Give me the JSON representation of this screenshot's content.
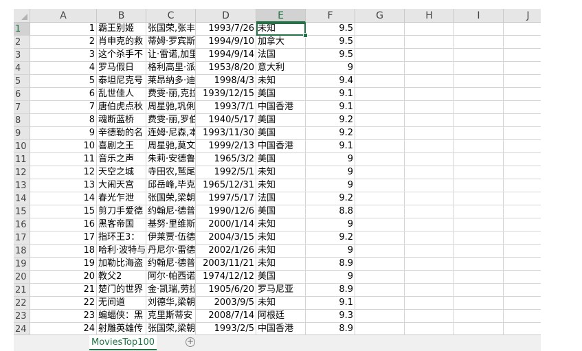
{
  "spreadsheet": {
    "columns": [
      "A",
      "B",
      "C",
      "D",
      "E",
      "F",
      "G",
      "H",
      "I",
      "J"
    ],
    "selected_column": "E",
    "selected_row": 1,
    "rows": [
      {
        "row": "1",
        "a": "1",
        "b": "霸王别姬",
        "c": "张国荣,张丰",
        "d": "1993/7/26",
        "e": "未知",
        "f": "9.5"
      },
      {
        "row": "2",
        "a": "2",
        "b": "肖申克的救",
        "c": "蒂姆·罗宾斯",
        "d": "1994/9/10",
        "e": "加拿大",
        "f": "9.5"
      },
      {
        "row": "3",
        "a": "3",
        "b": "这个杀手不",
        "c": "让·雷诺,加里",
        "d": "1994/9/14",
        "e": "法国",
        "f": "9.5"
      },
      {
        "row": "4",
        "a": "4",
        "b": "罗马假日",
        "c": "格利高里·派",
        "d": "1953/8/20",
        "e": "意大利",
        "f": "9"
      },
      {
        "row": "5",
        "a": "5",
        "b": "泰坦尼克号",
        "c": "莱昂纳多·迪",
        "d": "1998/4/3",
        "e": "未知",
        "f": "9.4"
      },
      {
        "row": "6",
        "a": "6",
        "b": "乱世佳人",
        "c": "费雯·丽,克拉",
        "d": "1939/12/15",
        "e": "美国",
        "f": "9.1"
      },
      {
        "row": "7",
        "a": "7",
        "b": "唐伯虎点秋",
        "c": "周星驰,巩俐",
        "d": "1993/7/1",
        "e": "中国香港",
        "f": "9.1"
      },
      {
        "row": "8",
        "a": "8",
        "b": "魂断蓝桥",
        "c": "费雯·丽,罗伯",
        "d": "1940/5/17",
        "e": "美国",
        "f": "9.2"
      },
      {
        "row": "9",
        "a": "9",
        "b": "辛德勒的名",
        "c": "连姆·尼森,本",
        "d": "1993/11/30",
        "e": "美国",
        "f": "9.2"
      },
      {
        "row": "10",
        "a": "10",
        "b": "喜剧之王",
        "c": "周星驰,莫文",
        "d": "1999/2/13",
        "e": "中国香港",
        "f": "9.1"
      },
      {
        "row": "11",
        "a": "11",
        "b": "音乐之声",
        "c": "朱莉·安德鲁",
        "d": "1965/3/2",
        "e": "美国",
        "f": "9"
      },
      {
        "row": "12",
        "a": "12",
        "b": "天空之城",
        "c": "寺田农,鹫尾",
        "d": "1992/5/1",
        "e": "未知",
        "f": "9"
      },
      {
        "row": "13",
        "a": "13",
        "b": "大闹天宫",
        "c": "邱岳峰,毕克",
        "d": "1965/12/31",
        "e": "未知",
        "f": "9"
      },
      {
        "row": "14",
        "a": "14",
        "b": "春光乍泄",
        "c": "张国荣,梁朝",
        "d": "1997/5/17",
        "e": "法国",
        "f": "9.2"
      },
      {
        "row": "15",
        "a": "15",
        "b": "剪刀手爱德",
        "c": "约翰尼·德普",
        "d": "1990/12/6",
        "e": "美国",
        "f": "8.8"
      },
      {
        "row": "16",
        "a": "16",
        "b": "黑客帝国",
        "c": "基努·里维斯",
        "d": "2000/1/14",
        "e": "未知",
        "f": "9"
      },
      {
        "row": "17",
        "a": "17",
        "b": "指环王3：",
        "c": "伊莱贾·伍德",
        "d": "2004/3/15",
        "e": "未知",
        "f": "9.2"
      },
      {
        "row": "18",
        "a": "18",
        "b": "哈利·波特与",
        "c": "丹尼尔·雷德",
        "d": "2002/1/26",
        "e": "未知",
        "f": "9"
      },
      {
        "row": "19",
        "a": "19",
        "b": "加勒比海盗",
        "c": "约翰尼·德普",
        "d": "2003/11/21",
        "e": "未知",
        "f": "8.9"
      },
      {
        "row": "20",
        "a": "20",
        "b": "教父2",
        "c": "阿尔·帕西诺",
        "d": "1974/12/12",
        "e": "美国",
        "f": "9"
      },
      {
        "row": "21",
        "a": "21",
        "b": "楚门的世界",
        "c": "金·凯瑞,劳拉",
        "d": "1905/6/20",
        "e": "罗马尼亚",
        "f": "8.9"
      },
      {
        "row": "22",
        "a": "22",
        "b": "无间道",
        "c": "刘德华,梁朝",
        "d": "2003/9/5",
        "e": "未知",
        "f": "9.1"
      },
      {
        "row": "23",
        "a": "23",
        "b": "蝙蝠侠：黑",
        "c": "克里斯蒂安",
        "d": "2008/7/14",
        "e": "阿根廷",
        "f": "9.3"
      },
      {
        "row": "24",
        "a": "24",
        "b": "射雕英雄传",
        "c": "张国荣,梁朝",
        "d": "1993/2/5",
        "e": "中国香港",
        "f": "8.9"
      }
    ]
  },
  "sheet_tabs": {
    "active_label": "MoviesTop100",
    "add_symbol": "+"
  },
  "colors": {
    "accent": "#217346",
    "header_bg": "#e6e6e6",
    "grid": "#d4d4d4"
  }
}
